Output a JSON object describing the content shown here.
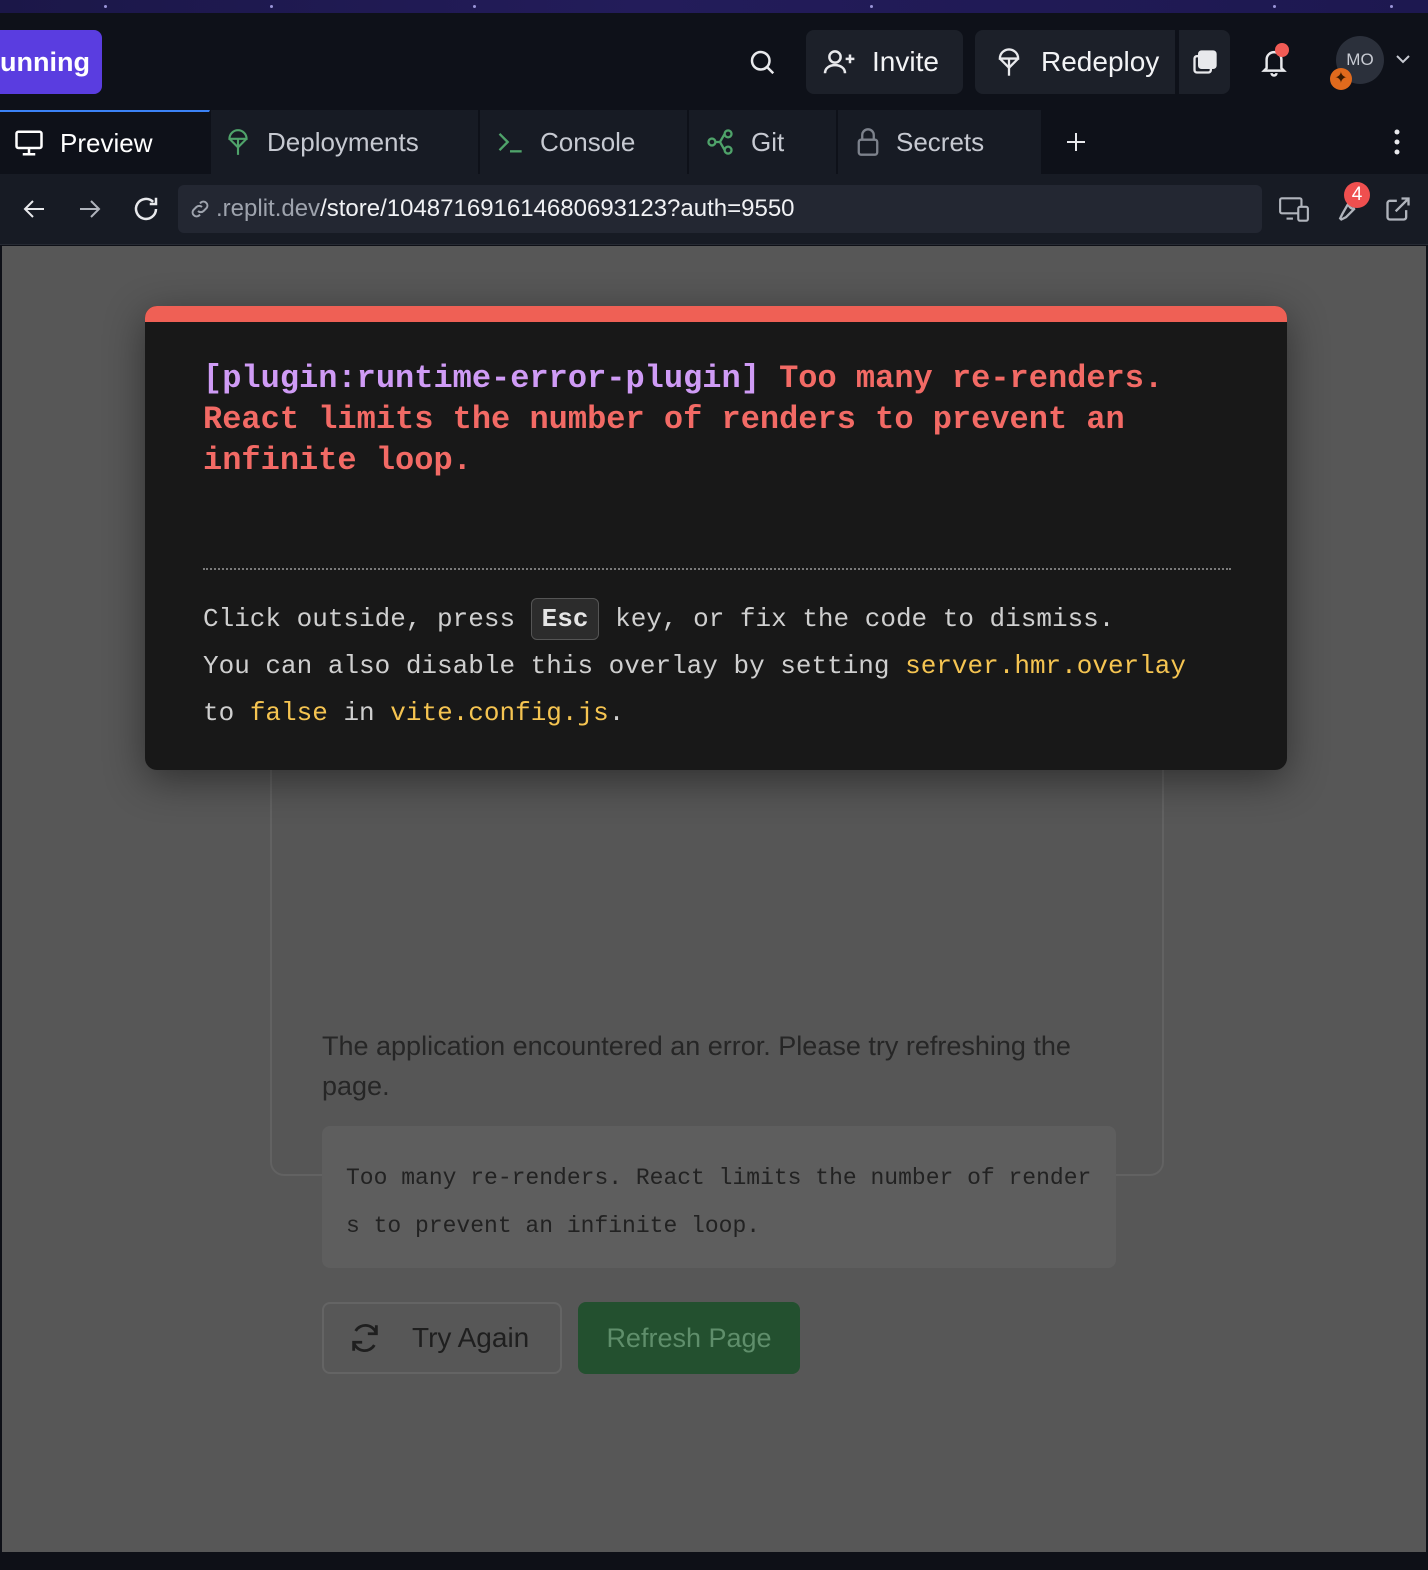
{
  "topbar": {
    "run_label": "unning",
    "invite_label": "Invite",
    "redeploy_label": "Redeploy",
    "avatar_initials": "MO",
    "avatar_badge": "✦",
    "accent_color": "#5a3de0"
  },
  "tabs": [
    {
      "label": "Preview",
      "icon": "monitor-icon"
    },
    {
      "label": "Deployments",
      "icon": "deploy-icon"
    },
    {
      "label": "Console",
      "icon": "console-icon"
    },
    {
      "label": "Git",
      "icon": "git-icon"
    },
    {
      "label": "Secrets",
      "icon": "lock-icon"
    }
  ],
  "url": {
    "host": ".replit.dev",
    "path": "/store/10487169161468069312­3?auth=9550",
    "badge_count": "4"
  },
  "overlay": {
    "plugin": "[plugin:runtime-error-plugin]",
    "message": "Too many re-renders. React limits the number of renders to prevent an infinite loop.",
    "tip_1": "Click outside, press",
    "tip_key": "Esc",
    "tip_2": "key, or fix the code to dismiss.",
    "tip_3": "You can also disable this overlay by setting",
    "tip_code_1": "server.hmr.overlay",
    "tip_4": "to",
    "tip_code_2": "false",
    "tip_5": "in",
    "tip_code_3": "vite.config.js",
    "tip_6": ".",
    "accent_color": "#ef6055"
  },
  "card": {
    "message": "The application encountered an error. Please try refreshing the page.",
    "error_text": "Too many re-renders. React limits the number of renders to prevent an infinite loop.",
    "try_again_label": "Try Again",
    "refresh_label": "Refresh Page"
  }
}
